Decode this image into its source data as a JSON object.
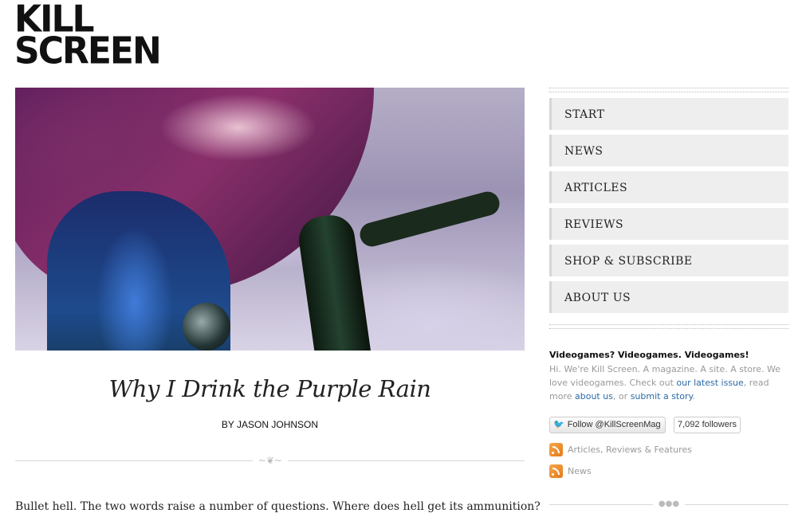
{
  "site": {
    "logo_line1": "KILL",
    "logo_line2": "SCREEN"
  },
  "article": {
    "title": "Why I Drink the Purple Rain",
    "byline": "BY JASON JOHNSON",
    "first_line": "Bullet hell. The two words raise a number of questions. Where does hell get its ammunition?"
  },
  "nav": {
    "items": [
      {
        "label": "START"
      },
      {
        "label": "NEWS"
      },
      {
        "label": "ARTICLES"
      },
      {
        "label": "REVIEWS"
      },
      {
        "label": "SHOP & SUBSCRIBE"
      },
      {
        "label": "ABOUT US"
      }
    ]
  },
  "about": {
    "heading": "Videogames? Videogames. Videogames!",
    "text1": "Hi. We're Kill Screen. A magazine. A site. A store. We love videogames. Check out ",
    "link_latest": "our latest issue",
    "text2": ", read more ",
    "link_about": "about us",
    "text3": ", or ",
    "link_submit": "submit a story",
    "text4": "."
  },
  "twitter": {
    "follow_label": "Follow @KillScreenMag",
    "followers": "7,092 followers"
  },
  "feeds": [
    {
      "label": "Articles, Reviews & Features"
    },
    {
      "label": "News"
    }
  ],
  "colors": {
    "link": "#2b6aa6",
    "rss": "#e37b18",
    "nav_bg": "#eeeeee"
  }
}
